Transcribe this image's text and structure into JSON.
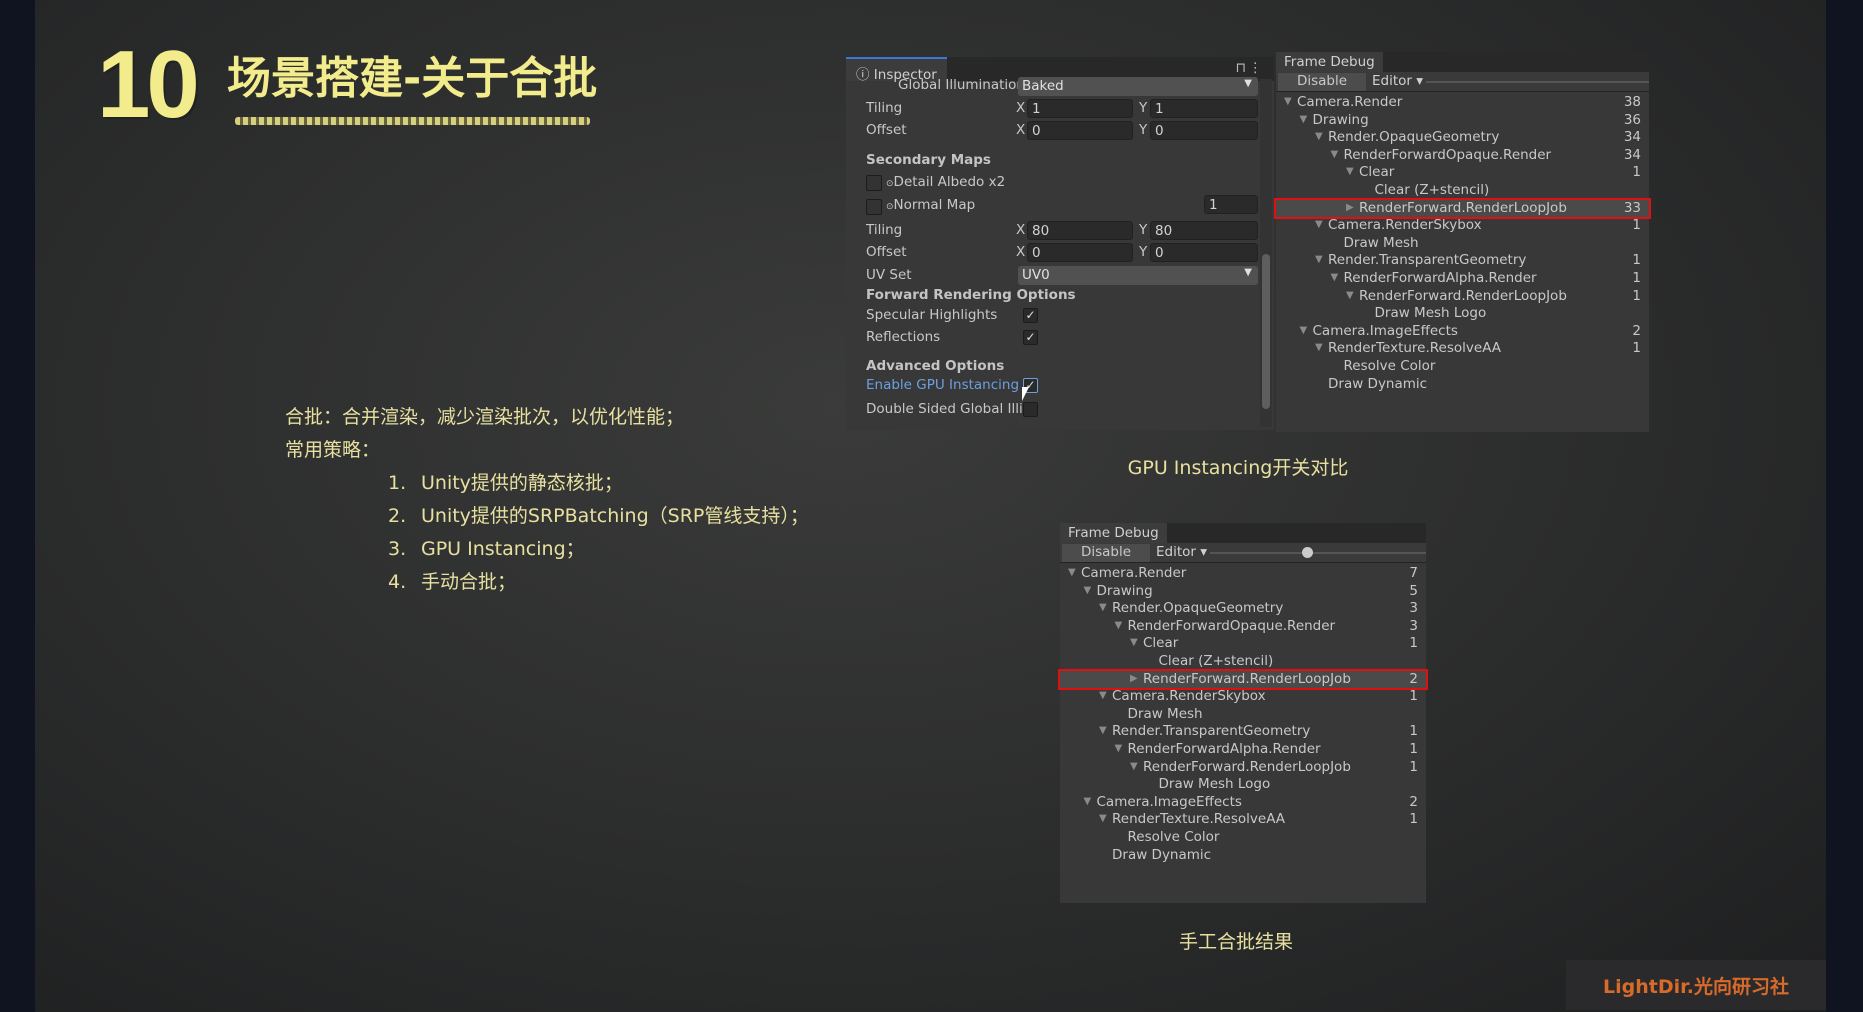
{
  "slide": {
    "number": "10",
    "title": "场景搭建-关于合批",
    "intro": "合批：合并渲染，减少渲染批次，以优化性能；",
    "strategies_label": "常用策略：",
    "strategies": [
      {
        "num": "1.",
        "text": "Unity提供的静态核批；"
      },
      {
        "num": "2.",
        "text": "Unity提供的SRPBatching（SRP管线支持）；"
      },
      {
        "num": "3.",
        "text": "GPU Instancing；"
      },
      {
        "num": "4.",
        "text": "手动合批；"
      }
    ],
    "caption_top": "GPU Instancing开关对比",
    "caption_bottom": "手工合批结果",
    "logo": "LightDir.光向研习社"
  },
  "inspector": {
    "tab": "Inspector",
    "gi_label": "Global Illuminatior",
    "gi_value": "Baked",
    "tiling1": {
      "label": "Tiling",
      "x": "1",
      "y": "1"
    },
    "offset1": {
      "label": "Offset",
      "x": "0",
      "y": "0"
    },
    "secondary_maps": "Secondary Maps",
    "detail_albedo": "Detail Albedo x2",
    "normal_map": "Normal Map",
    "normal_value": "1",
    "tiling2": {
      "label": "Tiling",
      "x": "80",
      "y": "80"
    },
    "offset2": {
      "label": "Offset",
      "x": "0",
      "y": "0"
    },
    "uv_set_label": "UV Set",
    "uv_set_value": "UV0",
    "forward_options": "Forward Rendering Options",
    "specular": "Specular Highlights",
    "reflections": "Reflections",
    "advanced": "Advanced Options",
    "gpu_instancing": "Enable GPU Instancing",
    "double_sided": "Double Sided Global Illi",
    "x_label": "X",
    "y_label": "Y",
    "check": "✓",
    "accent": "#6d9fe0"
  },
  "frame_debug_top": {
    "tab": "Frame Debug",
    "disable": "Disable",
    "editor": "Editor ▾",
    "rows": [
      {
        "d": 0,
        "t": "▼",
        "l": "Camera.Render",
        "c": "38"
      },
      {
        "d": 1,
        "t": "▼",
        "l": "Drawing",
        "c": "36"
      },
      {
        "d": 2,
        "t": "▼",
        "l": "Render.OpaqueGeometry",
        "c": "34"
      },
      {
        "d": 3,
        "t": "▼",
        "l": "RenderForwardOpaque.Render",
        "c": "34"
      },
      {
        "d": 4,
        "t": "▼",
        "l": "Clear",
        "c": "1"
      },
      {
        "d": 5,
        "t": "",
        "l": "Clear (Z+stencil)",
        "c": ""
      },
      {
        "d": 4,
        "t": "▶",
        "l": "RenderForward.RenderLoopJob",
        "c": "33",
        "sel": true
      },
      {
        "d": 2,
        "t": "▼",
        "l": "Camera.RenderSkybox",
        "c": "1"
      },
      {
        "d": 3,
        "t": "",
        "l": "Draw Mesh",
        "c": ""
      },
      {
        "d": 2,
        "t": "▼",
        "l": "Render.TransparentGeometry",
        "c": "1"
      },
      {
        "d": 3,
        "t": "▼",
        "l": "RenderForwardAlpha.Render",
        "c": "1"
      },
      {
        "d": 4,
        "t": "▼",
        "l": "RenderForward.RenderLoopJob",
        "c": "1"
      },
      {
        "d": 5,
        "t": "",
        "l": "Draw Mesh Logo",
        "c": ""
      },
      {
        "d": 1,
        "t": "▼",
        "l": "Camera.ImageEffects",
        "c": "2"
      },
      {
        "d": 2,
        "t": "▼",
        "l": "RenderTexture.ResolveAA",
        "c": "1"
      },
      {
        "d": 3,
        "t": "",
        "l": "Resolve Color",
        "c": ""
      },
      {
        "d": 2,
        "t": "",
        "l": "Draw Dynamic",
        "c": ""
      }
    ]
  },
  "frame_debug_bottom": {
    "tab": "Frame Debug",
    "disable": "Disable",
    "editor": "Editor ▾",
    "rows": [
      {
        "d": 0,
        "t": "▼",
        "l": "Camera.Render",
        "c": "7"
      },
      {
        "d": 1,
        "t": "▼",
        "l": "Drawing",
        "c": "5"
      },
      {
        "d": 2,
        "t": "▼",
        "l": "Render.OpaqueGeometry",
        "c": "3"
      },
      {
        "d": 3,
        "t": "▼",
        "l": "RenderForwardOpaque.Render",
        "c": "3"
      },
      {
        "d": 4,
        "t": "▼",
        "l": "Clear",
        "c": "1"
      },
      {
        "d": 5,
        "t": "",
        "l": "Clear (Z+stencil)",
        "c": ""
      },
      {
        "d": 4,
        "t": "▶",
        "l": "RenderForward.RenderLoopJob",
        "c": "2",
        "sel": true
      },
      {
        "d": 2,
        "t": "▼",
        "l": "Camera.RenderSkybox",
        "c": "1"
      },
      {
        "d": 3,
        "t": "",
        "l": "Draw Mesh",
        "c": ""
      },
      {
        "d": 2,
        "t": "▼",
        "l": "Render.TransparentGeometry",
        "c": "1"
      },
      {
        "d": 3,
        "t": "▼",
        "l": "RenderForwardAlpha.Render",
        "c": "1"
      },
      {
        "d": 4,
        "t": "▼",
        "l": "RenderForward.RenderLoopJob",
        "c": "1"
      },
      {
        "d": 5,
        "t": "",
        "l": "Draw Mesh Logo",
        "c": ""
      },
      {
        "d": 1,
        "t": "▼",
        "l": "Camera.ImageEffects",
        "c": "2"
      },
      {
        "d": 2,
        "t": "▼",
        "l": "RenderTexture.ResolveAA",
        "c": "1"
      },
      {
        "d": 3,
        "t": "",
        "l": "Resolve Color",
        "c": ""
      },
      {
        "d": 2,
        "t": "",
        "l": "Draw Dynamic",
        "c": ""
      }
    ]
  }
}
